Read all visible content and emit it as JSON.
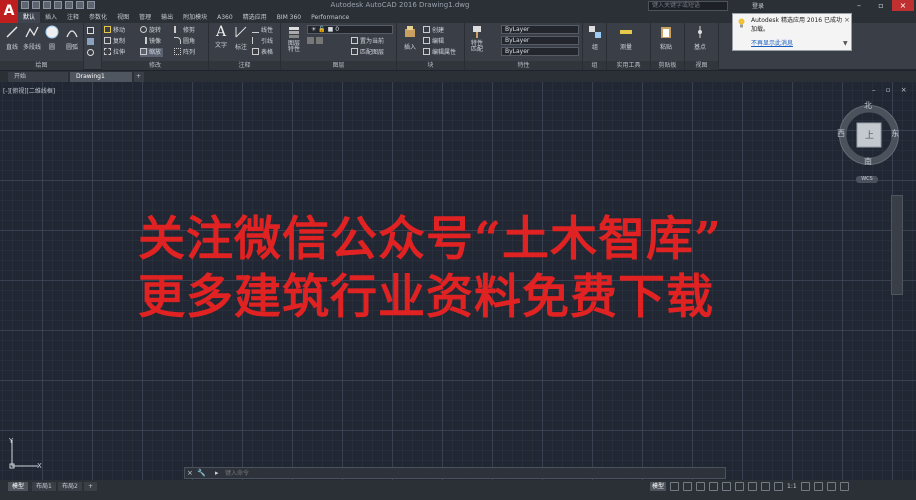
{
  "window": {
    "title": "Autodesk AutoCAD 2016  Drawing1.dwg",
    "search_placeholder": "键入关键字或短语",
    "login_label": "登录"
  },
  "ribbon_tabs": [
    "默认",
    "插入",
    "注释",
    "参数化",
    "视图",
    "管理",
    "输出",
    "附加模块",
    "A360",
    "精选应用",
    "BIM 360",
    "Performance"
  ],
  "ribbon": {
    "draw": {
      "title": "绘图",
      "buttons": [
        "直线",
        "多段线",
        "圆",
        "圆弧"
      ]
    },
    "modify": {
      "title": "修改",
      "items": [
        "移动",
        "旋转",
        "修剪",
        "复制",
        "镜像",
        "圆角",
        "拉伸",
        "缩放",
        "阵列"
      ]
    },
    "annotation": {
      "title": "注释",
      "buttons": [
        "文字",
        "标注"
      ],
      "items": [
        "线性",
        "引线",
        "表格"
      ]
    },
    "layers": {
      "title": "图层",
      "button": "图层特性",
      "items": [
        "置为当前",
        "匹配图层"
      ]
    },
    "block": {
      "title": "块",
      "button": "插入",
      "items": [
        "创建",
        "编辑",
        "编辑属性"
      ]
    },
    "properties": {
      "title": "特性",
      "button": "特性匹配",
      "combos": [
        "ByLayer",
        "ByLayer",
        "ByLayer"
      ]
    },
    "groups": {
      "title": "组",
      "button": "组"
    },
    "utilities": {
      "title": "实用工具",
      "button": "测量"
    },
    "clipboard": {
      "title": "剪贴板",
      "button": "粘贴"
    },
    "view": {
      "title": "视图",
      "button": "基点"
    }
  },
  "notification": {
    "title": "Autodesk 精选应用 2016 已成功",
    "line2": "加载。",
    "link": "不再显示此消息"
  },
  "doc_tabs": {
    "start": "开始",
    "drawing": "Drawing1",
    "add": "+"
  },
  "viewport": {
    "label": "[-][俯视][二维线框]",
    "controls": "– ▫ ×"
  },
  "watermark": {
    "line1": "关注微信公众号“土木智库”",
    "line2": "更多建筑行业资料免费下载"
  },
  "viewcube": {
    "north": "北",
    "south": "南",
    "east": "东",
    "west": "西",
    "face": "上",
    "wcs": "WCS"
  },
  "ucs": {
    "x": "X",
    "y": "Y"
  },
  "command": {
    "placeholder": "键入命令",
    "close": "×",
    "tool": "🔧",
    "caret": "▸"
  },
  "layout_tabs": [
    "模型",
    "布局1",
    "布局2"
  ],
  "status": {
    "model": "模型",
    "scale": "1:1"
  },
  "colors": {
    "watermark": "#e02222",
    "app_red": "#bf1e1e",
    "canvas": "#212733"
  }
}
